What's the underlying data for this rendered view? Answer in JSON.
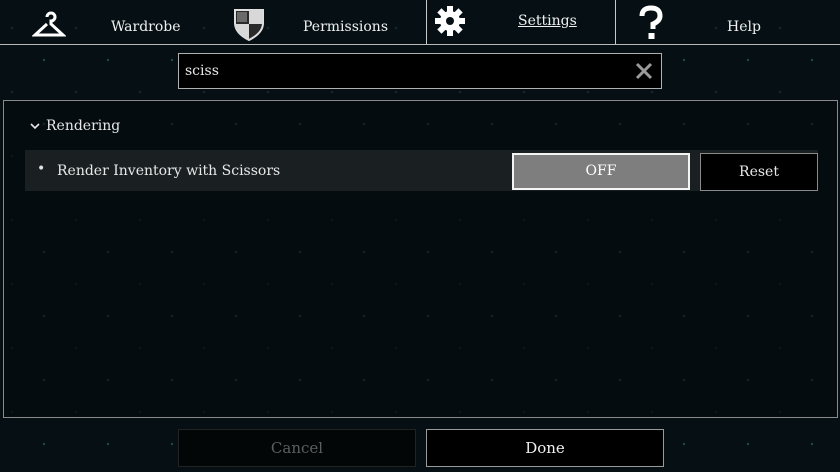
{
  "tabs": [
    {
      "label": "Wardrobe",
      "icon": "hanger-icon",
      "active": false
    },
    {
      "label": "Permissions",
      "icon": "shield-icon",
      "active": false
    },
    {
      "label": "Settings",
      "icon": "gear-icon",
      "active": true
    },
    {
      "label": "Help",
      "icon": "question-mark-icon",
      "active": false
    }
  ],
  "search": {
    "value": "sciss",
    "clear_icon": "close-icon"
  },
  "section": {
    "title": "Rendering",
    "expanded": true
  },
  "setting": {
    "bullet": "•",
    "label": "Render Inventory with Scissors",
    "value": "OFF",
    "reset_label": "Reset"
  },
  "footer": {
    "cancel_label": "Cancel",
    "done_label": "Done",
    "cancel_enabled": false
  }
}
